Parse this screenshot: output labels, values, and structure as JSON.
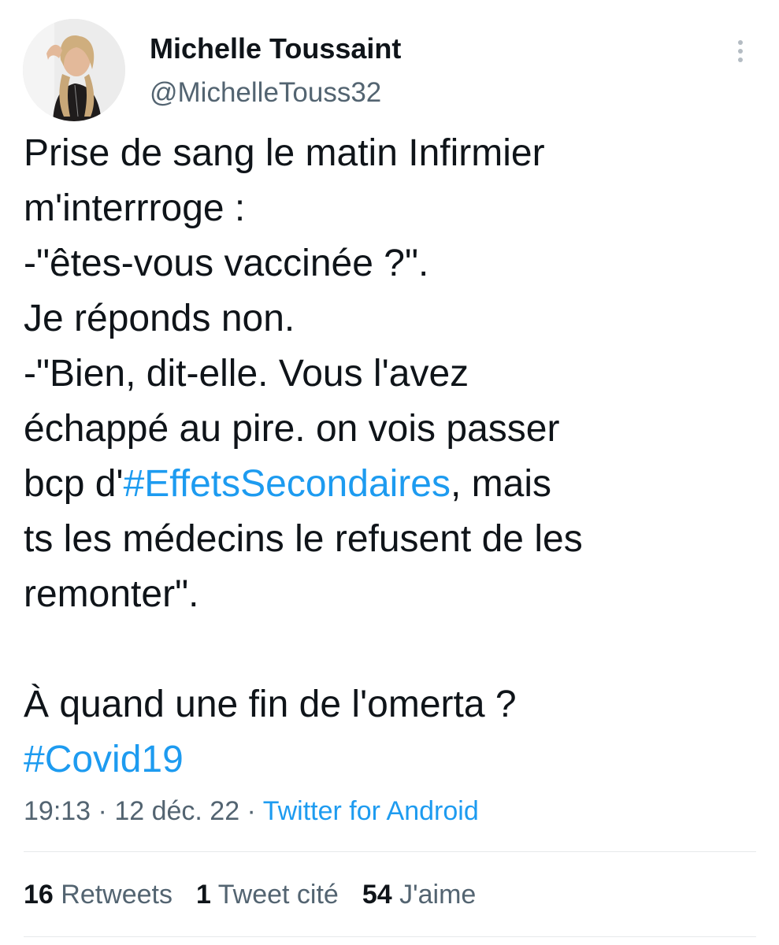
{
  "author": {
    "display_name": "Michelle Toussaint",
    "handle": "@MichelleTouss32"
  },
  "tweet": {
    "lines": [
      [
        {
          "text": "Prise de sang le matin  Infirmier",
          "hashtag": false
        }
      ],
      [
        {
          "text": "m'interrroge :",
          "hashtag": false
        }
      ],
      [
        {
          "text": "-\"êtes-vous vaccinée ?\".",
          "hashtag": false
        }
      ],
      [
        {
          "text": "Je réponds non.",
          "hashtag": false
        }
      ],
      [
        {
          "text": "-\"Bien, dit-elle. Vous l'avez",
          "hashtag": false
        }
      ],
      [
        {
          "text": "échappé au pire. on vois passer",
          "hashtag": false
        }
      ],
      [
        {
          "text": "bcp d'",
          "hashtag": false
        },
        {
          "text": "#EffetsSecondaires",
          "hashtag": true
        },
        {
          "text": ", mais",
          "hashtag": false
        }
      ],
      [
        {
          "text": "ts les médecins le refusent de les",
          "hashtag": false
        }
      ],
      [
        {
          "text": "remonter\".",
          "hashtag": false
        }
      ],
      [],
      [
        {
          "text": "À quand une fin de l'omerta ?",
          "hashtag": false
        }
      ],
      [
        {
          "text": "#Covid19",
          "hashtag": true
        }
      ]
    ]
  },
  "meta": {
    "time": "19:13",
    "date": "12 déc. 22",
    "separator": " · ",
    "source": "Twitter for Android"
  },
  "stats": {
    "retweets": {
      "count": "16",
      "label": " Retweets"
    },
    "quotes": {
      "count": "1",
      "label": " Tweet cité"
    },
    "likes": {
      "count": "54",
      "label": " J'aime"
    }
  },
  "icons": {
    "more": "more-vertical-icon"
  },
  "colors": {
    "text": "#0f1419",
    "secondary": "#536471",
    "link": "#1d9bf0",
    "divider": "#e6e9eb"
  }
}
